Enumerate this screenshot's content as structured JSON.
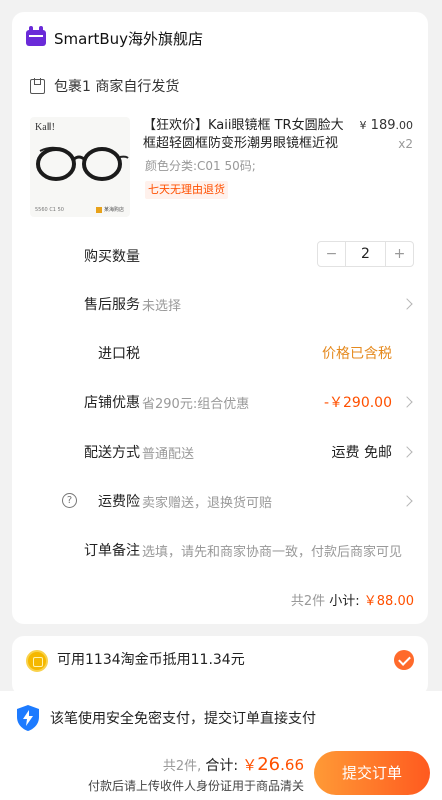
{
  "store": {
    "name": "SmartBuy海外旗舰店",
    "package_text": "包裹1 商家自行发货"
  },
  "product": {
    "image_brand": "KaⅡ!",
    "image_sku": "5560 C1 50",
    "image_logo_text": "某海购店",
    "title": "【狂欢价】Kaii眼镜框 TR女圆脸大框超轻圆框防变形潮男眼镜框近视",
    "price_symbol": "¥",
    "price_int": "189",
    "price_dec": ".00",
    "quantity": "x2",
    "sku": "颜色分类:C01 50码;",
    "return_tag": "七天无理由退货"
  },
  "rows": {
    "quantity_label": "购买数量",
    "quantity_value": "2",
    "minus": "−",
    "plus": "+",
    "aftersale_label": "售后服务",
    "aftersale_value": "未选择",
    "tax_label": "进口税",
    "tax_value": "价格已含税",
    "discount_label": "店铺优惠",
    "discount_desc": "省290元:组合优惠",
    "discount_value": "-￥290.00",
    "shipping_label": "配送方式",
    "shipping_method": "普通配送",
    "shipping_value": "运费 免邮",
    "insurance_icon": "?",
    "insurance_label": "运费险",
    "insurance_desc": "卖家赠送，退换货可赔",
    "note_label": "订单备注",
    "note_placeholder": "选填，请先和商家协商一致，付款后商家可见"
  },
  "subtotal": {
    "count_text": "共2件",
    "label": "小计:",
    "amount": "￥88.00"
  },
  "coin": {
    "text": "可用1134淘金币抵用11.34元",
    "checked": true
  },
  "secure": {
    "text": "该笔使用安全免密支付，提交订单直接支付"
  },
  "footer": {
    "count_text": "共2件,",
    "total_label": "合计:",
    "currency": "￥",
    "amount_int": "26",
    "amount_dec": ".66",
    "note": "付款后请上传收件人身份证用于商品清关",
    "submit_label": "提交订单"
  },
  "colors": {
    "accent": "#ff5000",
    "tax_orange": "#e58a1f",
    "tmall_purple": "#6a2ad8",
    "shield_blue": "#1d7bff"
  },
  "icons": {
    "store": "tmall-icon",
    "package": "box-icon",
    "chevron": "chevron-right-icon",
    "coin": "gold-coin-icon",
    "check": "check-circle-icon",
    "security": "shield-lightning-icon"
  }
}
